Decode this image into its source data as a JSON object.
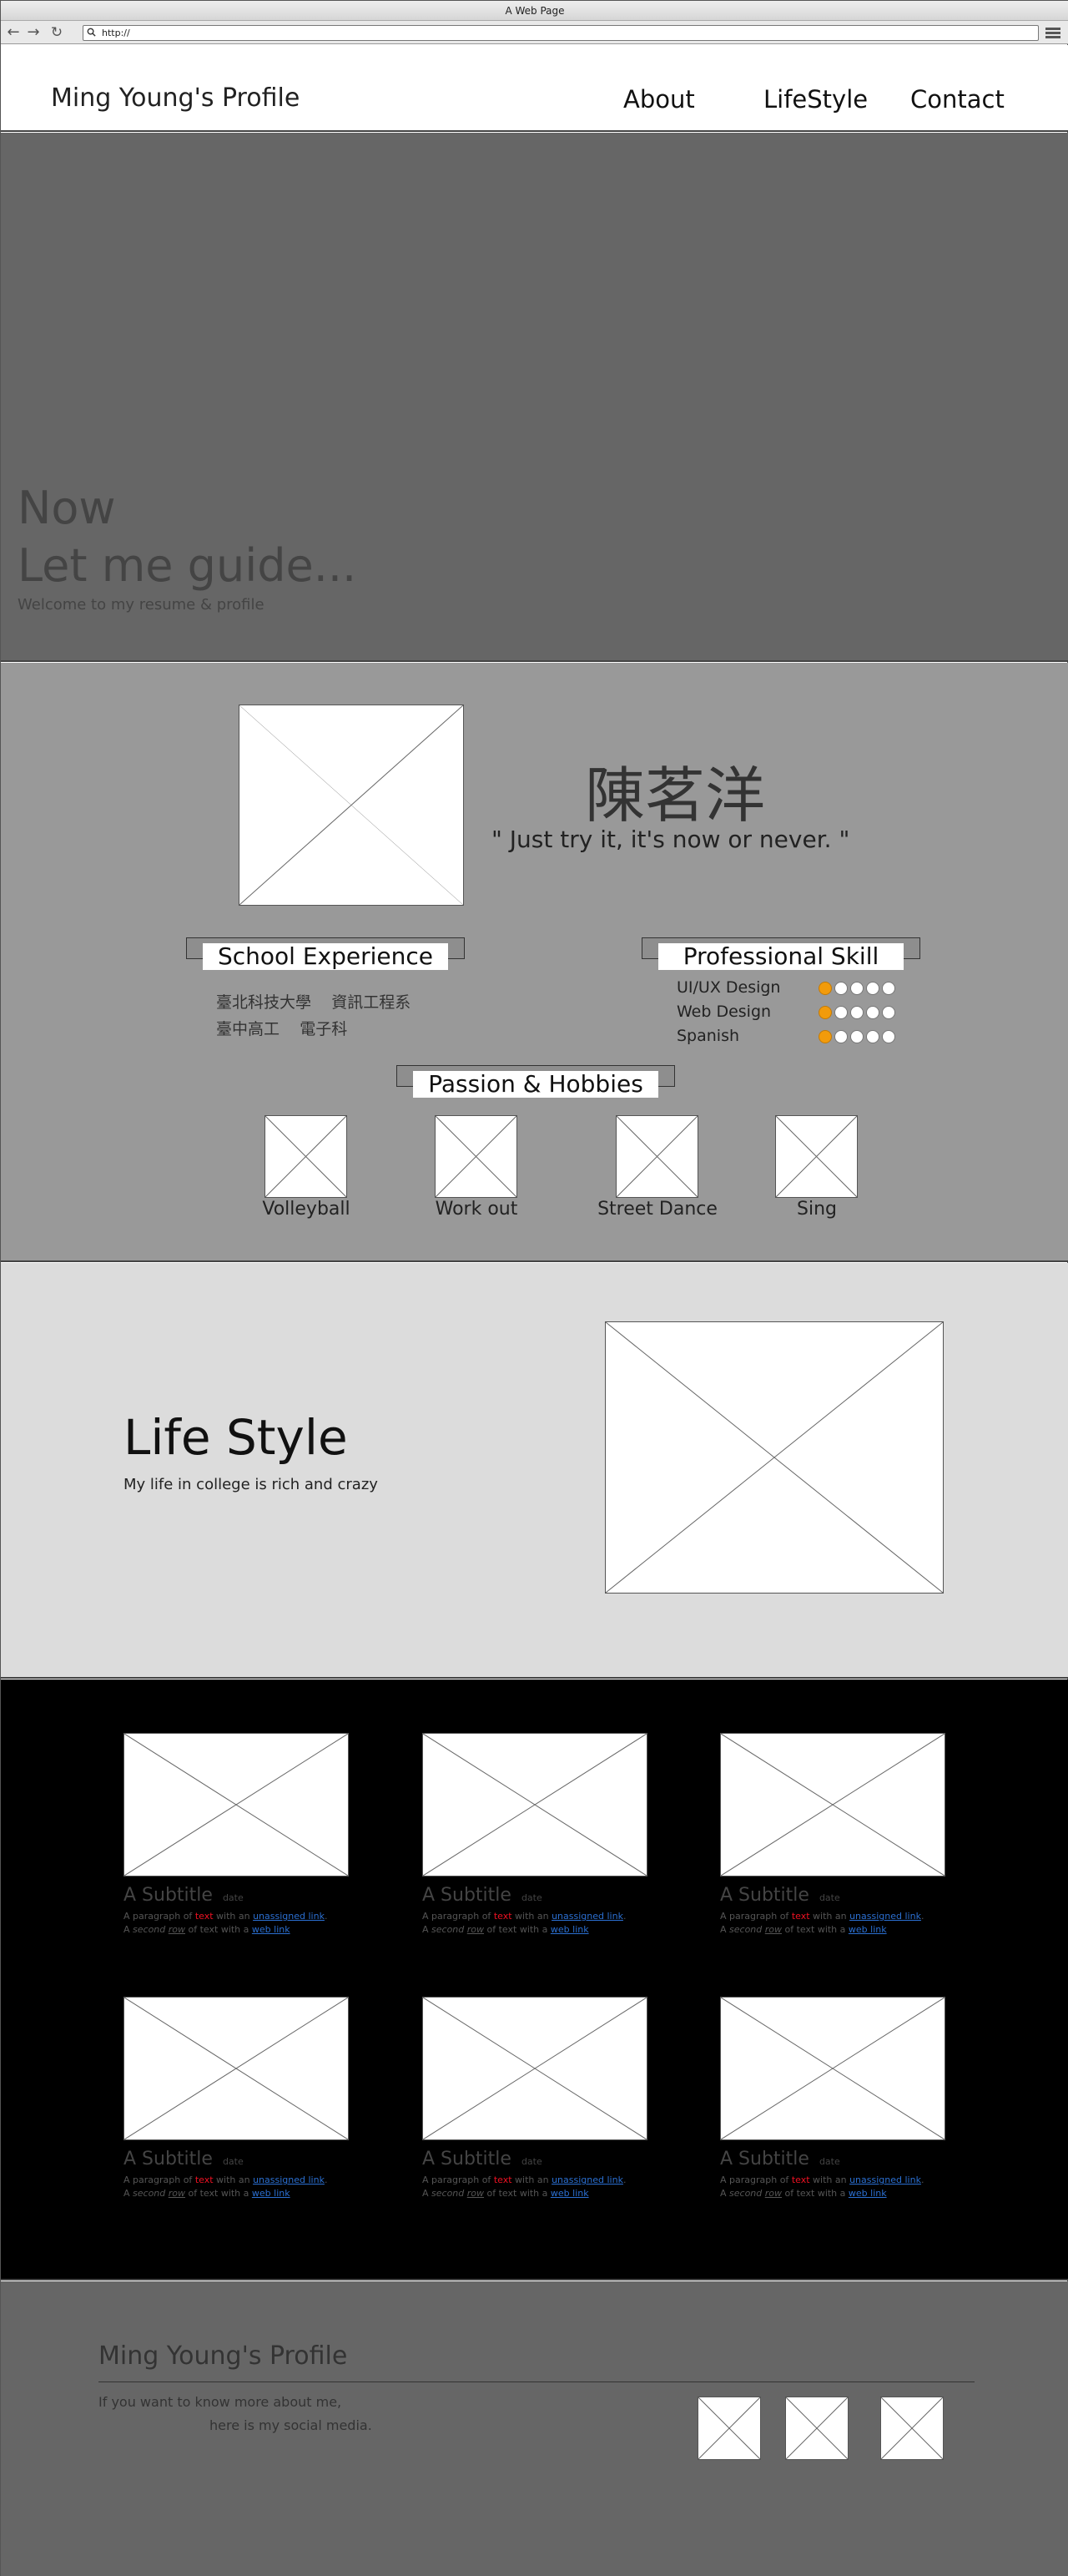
{
  "browser": {
    "window_title": "A Web Page",
    "url": "http://",
    "back_icon": "arrow-left-icon",
    "forward_icon": "arrow-right-icon",
    "reload_icon": "reload-icon",
    "menu_icon": "hamburger-menu-icon"
  },
  "header": {
    "site_title": "Ming Young's Profile",
    "nav": [
      "About",
      "LifeStyle",
      "Contact"
    ]
  },
  "hero": {
    "line1": "Now",
    "line2": "Let me guide...",
    "subtitle": "Welcome to my resume & profile"
  },
  "profile": {
    "name": "陳茗洋",
    "quote": "\" Just try it, it's now or never. \"",
    "school_heading": "School Experience",
    "school": [
      {
        "school": "臺北科技大學",
        "dept": "資訊工程系"
      },
      {
        "school": "臺中高工",
        "dept": "電子科"
      }
    ],
    "skill_heading": "Professional Skill",
    "skills": [
      {
        "name": "UI/UX Design",
        "level": 1,
        "max": 5
      },
      {
        "name": "Web Design",
        "level": 1,
        "max": 5
      },
      {
        "name": "Spanish",
        "level": 1,
        "max": 5
      }
    ],
    "hobby_heading": "Passion & Hobbies",
    "hobbies": [
      "Volleyball",
      "Work out",
      "Street Dance",
      "Sing"
    ]
  },
  "lifestyle": {
    "title": "Life Style",
    "subtitle": "My life in college is rich and crazy"
  },
  "gallery": {
    "cards": [
      {
        "subtitle": "A Subtitle",
        "date": "date"
      },
      {
        "subtitle": "A Subtitle",
        "date": "date"
      },
      {
        "subtitle": "A Subtitle",
        "date": "date"
      },
      {
        "subtitle": "A Subtitle",
        "date": "date"
      },
      {
        "subtitle": "A Subtitle",
        "date": "date"
      },
      {
        "subtitle": "A Subtitle",
        "date": "date"
      }
    ],
    "p1_a": "A paragraph of ",
    "p1_red": "text",
    "p1_b": " with an ",
    "p1_link": "unassigned link",
    "p1_c": ".",
    "p2_a": "A ",
    "p2_it1": "second",
    "p2_b": " ",
    "p2_it2": "row",
    "p2_c": " of text with a ",
    "p2_link": "web link"
  },
  "footer": {
    "title": "Ming Young's Profile",
    "line1": "If you want to know more about me,",
    "line2": "here is my social media."
  },
  "colors": {
    "hero_bg": "#666666",
    "profile_bg": "#999999",
    "lifestyle_bg": "#dcdcdc",
    "gallery_bg": "#000000",
    "footer_bg": "#666666",
    "skill_dot_active": "#f29b0b",
    "link": "#2b6fd1",
    "emphasis_red": "#ee1122"
  }
}
